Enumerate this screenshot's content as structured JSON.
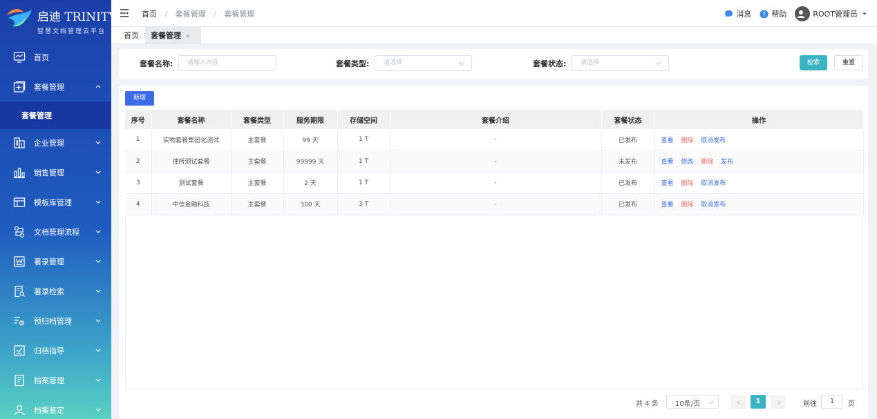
{
  "brand": {
    "title": "启迪 TRINITY",
    "subtitle": "智慧文档管理云平台"
  },
  "sidebar": {
    "items": [
      {
        "label": "首页",
        "icon": "monitor-chart-icon"
      },
      {
        "label": "套餐管理",
        "icon": "plus-square-icon",
        "expanded": true
      },
      {
        "label": "企业管理",
        "icon": "building-icon"
      },
      {
        "label": "销售管理",
        "icon": "bar-chart-icon"
      },
      {
        "label": "模板库管理",
        "icon": "template-icon"
      },
      {
        "label": "文档管理流程",
        "icon": "workflow-icon"
      },
      {
        "label": "著录管理",
        "icon": "word-doc-icon"
      },
      {
        "label": "著录检索",
        "icon": "doc-search-icon"
      },
      {
        "label": "预归档管理",
        "icon": "filter-list-icon"
      },
      {
        "label": "归档指导",
        "icon": "check-doc-icon"
      },
      {
        "label": "档案管理",
        "icon": "archive-icon"
      },
      {
        "label": "档案鉴定",
        "icon": "user-check-icon"
      }
    ],
    "sub_active": "套餐管理"
  },
  "topbar": {
    "breadcrumb": [
      "首页",
      "套餐管理",
      "套餐管理"
    ],
    "messages": "消息",
    "help": "帮助",
    "user": "ROOT管理员"
  },
  "tabs": [
    {
      "label": "首页",
      "active": false
    },
    {
      "label": "套餐管理",
      "active": true,
      "close": "×"
    }
  ],
  "filters": {
    "name_label": "套餐名称:",
    "name_placeholder": "请输入内容",
    "type_label": "套餐类型:",
    "type_placeholder": "请选择",
    "status_label": "套餐状态:",
    "status_placeholder": "请选择",
    "search": "检索",
    "reset": "重置"
  },
  "actions": {
    "add": "新增"
  },
  "table": {
    "columns": [
      "序号",
      "套餐名称",
      "套餐类型",
      "服务期限",
      "存储空间",
      "套餐介绍",
      "套餐状态",
      "操作"
    ],
    "rows": [
      {
        "index": "1",
        "name": "实物套餐集团化测试",
        "type": "主套餐",
        "term": "99 天",
        "storage": "1 T",
        "intro": "-",
        "status": "已发布",
        "ops": [
          "查看",
          "删除",
          "取消发布"
        ]
      },
      {
        "index": "2",
        "name": "律所测试套餐",
        "type": "主套餐",
        "term": "99999 天",
        "storage": "1 T",
        "intro": "-",
        "status": "未发布",
        "ops": [
          "查看",
          "修改",
          "删除",
          "发布"
        ]
      },
      {
        "index": "3",
        "name": "测试套餐",
        "type": "主套餐",
        "term": "2 天",
        "storage": "1 T",
        "intro": "-",
        "status": "已发布",
        "ops": [
          "查看",
          "删除",
          "取消发布"
        ]
      },
      {
        "index": "4",
        "name": "中信金融科技",
        "type": "主套餐",
        "term": "300 天",
        "storage": "3 T",
        "intro": "-",
        "status": "已发布",
        "ops": [
          "查看",
          "删除",
          "取消发布"
        ]
      }
    ]
  },
  "pagination": {
    "total": "共 4 条",
    "page_size": "10条/页",
    "current": "1",
    "goto_prefix": "前往",
    "goto_value": "1",
    "goto_suffix": "页"
  },
  "colors": {
    "primary": "#3d6ce6",
    "search": "#3bb3c3",
    "danger": "#f56c6c"
  }
}
